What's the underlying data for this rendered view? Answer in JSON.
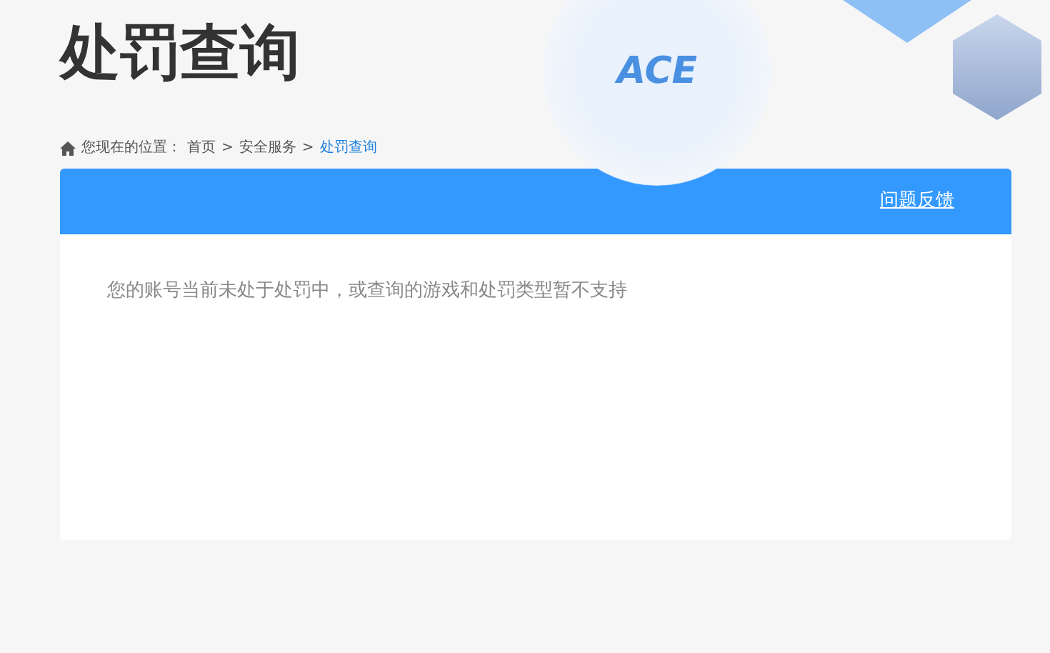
{
  "header": {
    "title": "处罚查询",
    "logo_text": "ACE"
  },
  "breadcrumb": {
    "prefix": "您现在的位置：",
    "items": [
      {
        "label": "首页",
        "current": false
      },
      {
        "label": "安全服务",
        "current": false
      },
      {
        "label": "处罚查询",
        "current": true
      }
    ],
    "separators": [
      ">",
      ">"
    ]
  },
  "panel": {
    "link": "问题反馈",
    "message": "您的账号当前未处于处罚中，或查询的游戏和处罚类型暂不支持"
  }
}
